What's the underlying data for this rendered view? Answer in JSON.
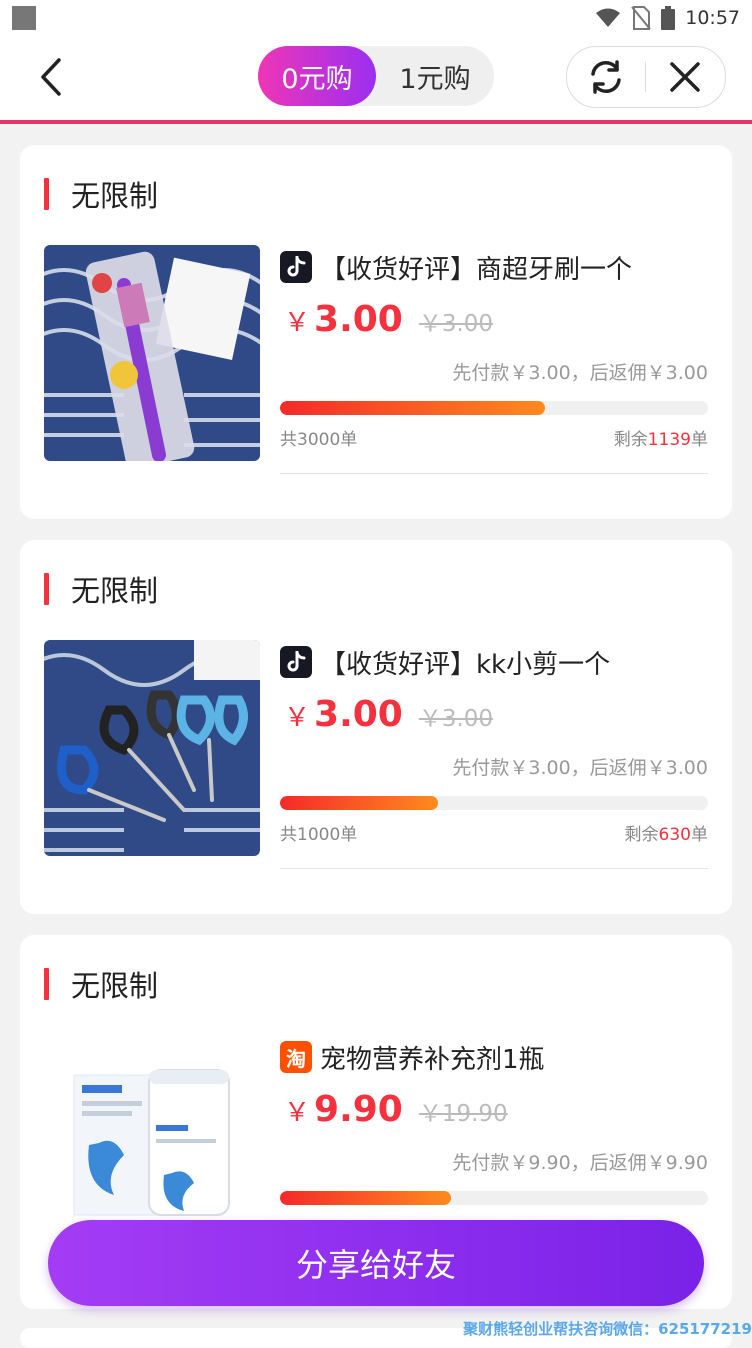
{
  "status_bar": {
    "time": "10:57"
  },
  "header": {
    "tabs": [
      {
        "label": "0元购",
        "active": true
      },
      {
        "label": "1元购",
        "active": false
      }
    ]
  },
  "colors": {
    "accent_red": "#f5313d",
    "brand_gradient": [
      "#ee36b6",
      "#9b2ff0"
    ],
    "top_line": "#e8336d",
    "button_purple": "#8a2ef0"
  },
  "products": [
    {
      "section_title": "无限制",
      "platform_icon": "douyin-icon",
      "name": "【收货好评】商超牙刷一个",
      "currency": "￥",
      "price": "3.00",
      "original_price": "￥3.00",
      "payment_note": "先付款￥3.00，后返佣￥3.00",
      "total_prefix": "共",
      "total_value": "3000单",
      "remaining_prefix": "剩余",
      "remaining_value": "1139",
      "remaining_unit": "单",
      "progress": 0.62
    },
    {
      "section_title": "无限制",
      "platform_icon": "douyin-icon",
      "name": "【收货好评】kk小剪一个",
      "currency": "￥",
      "price": "3.00",
      "original_price": "￥3.00",
      "payment_note": "先付款￥3.00，后返佣￥3.00",
      "total_prefix": "共",
      "total_value": "1000单",
      "remaining_prefix": "剩余",
      "remaining_value": "630",
      "remaining_unit": "单",
      "progress": 0.37
    },
    {
      "section_title": "无限制",
      "platform_icon": "taobao-icon",
      "platform_char": "淘",
      "name": "宠物营养补充剂1瓶",
      "currency": "￥",
      "price": "9.90",
      "original_price": "￥19.90",
      "payment_note": "先付款￥9.90，后返佣￥9.90",
      "progress": 0.4
    }
  ],
  "share_button": {
    "label": "分享给好友"
  },
  "watermark": "聚财熊轻创业帮扶咨询微信：625177219"
}
